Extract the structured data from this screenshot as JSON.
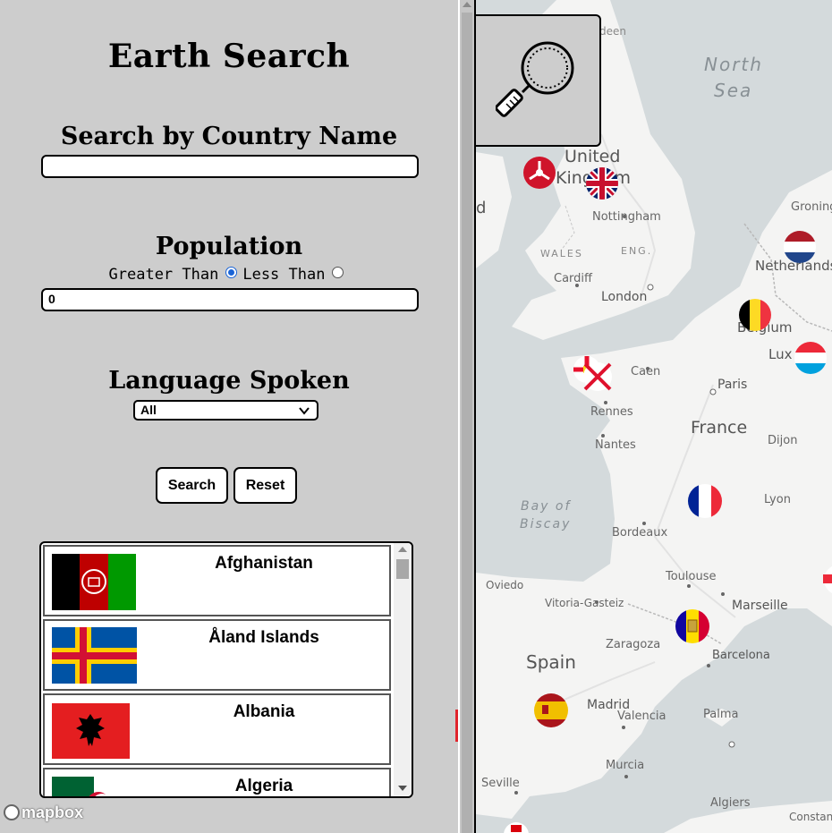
{
  "app": {
    "title": "Earth Search"
  },
  "search": {
    "heading": "Search by Country Name",
    "value": ""
  },
  "population": {
    "heading": "Population",
    "greater_label": "Greater Than",
    "less_label": "Less Than",
    "selected": "Greater Than",
    "value": "0"
  },
  "language": {
    "heading": "Language Spoken",
    "selected": "All"
  },
  "buttons": {
    "search": "Search",
    "reset": "Reset"
  },
  "countries": [
    {
      "name": "Afghanistan",
      "flag": "afghanistan-flag"
    },
    {
      "name": "Åland Islands",
      "flag": "aland-flag"
    },
    {
      "name": "Albania",
      "flag": "albania-flag"
    },
    {
      "name": "Algeria",
      "flag": "algeria-flag"
    }
  ],
  "map": {
    "attribution": "mapbox",
    "labels": {
      "north_sea_1": "North",
      "north_sea_2": "Sea",
      "united": "United",
      "kingdom": "Kingdom",
      "nottingham": "Nottingham",
      "wales": "WALES",
      "eng": "ENG.",
      "cardiff": "Cardiff",
      "london": "London",
      "groningen": "Groningen",
      "netherlands": "Netherlands",
      "belgium": "Belgium",
      "luxembourg": "Lux",
      "caen": "Caen",
      "paris": "Paris",
      "rennes": "Rennes",
      "france": "France",
      "dijon": "Dijon",
      "nantes": "Nantes",
      "bay1": "Bay of",
      "bay2": "Biscay",
      "lyon": "Lyon",
      "bordeaux": "Bordeaux",
      "toulouse": "Toulouse",
      "oviedo": "Oviedo",
      "vitoria": "Vitoria-Gasteiz",
      "marseille": "Marseille",
      "zaragoza": "Zaragoza",
      "spain": "Spain",
      "barcelona": "Barcelona",
      "madrid": "Madrid",
      "valencia": "Valencia",
      "palma": "Palma",
      "murcia": "Murcia",
      "seville": "Seville",
      "algiers": "Algiers",
      "constantine": "Constan",
      "aberdeen": "deen",
      "d_edge": "d"
    }
  },
  "colors": {
    "panel": "#cdcdcd",
    "water": "#d4dadc",
    "land": "#f4f4f3",
    "radio_accent": "#1a64d6"
  }
}
